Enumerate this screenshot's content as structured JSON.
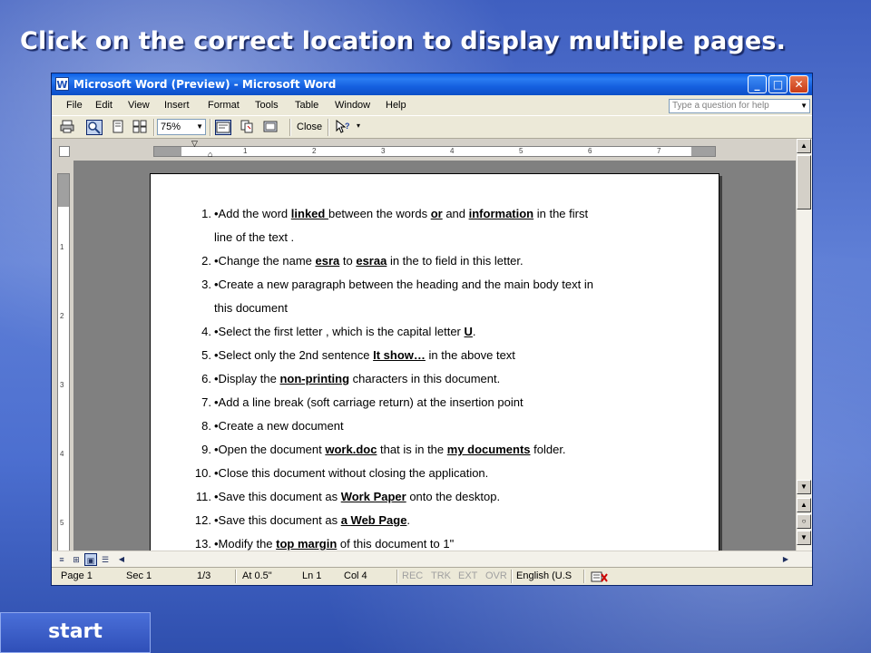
{
  "slide": {
    "instruction": "Click on the correct location to display multiple pages.",
    "start_label": "start"
  },
  "window": {
    "title": "Microsoft Word (Preview) - Microsoft Word",
    "controls": {
      "minimize": "_",
      "maximize": "□",
      "close": "✕"
    }
  },
  "menu": {
    "items": [
      "File",
      "Edit",
      "View",
      "Insert",
      "Format",
      "Tools",
      "Table",
      "Window",
      "Help"
    ],
    "help_placeholder": "Type a question for help"
  },
  "toolbar": {
    "zoom": "75%",
    "close_label": "Close"
  },
  "ruler": {
    "numbers": [
      "1",
      "2",
      "3",
      "4",
      "5",
      "6",
      "7"
    ],
    "vnumbers": [
      "1",
      "2",
      "3",
      "4",
      "5"
    ]
  },
  "document": {
    "items": [
      {
        "num": "1.",
        "parts": [
          [
            "•Add the word ",
            false
          ],
          [
            "linked ",
            true
          ],
          [
            "between the words ",
            false
          ],
          [
            "or",
            true
          ],
          [
            " and ",
            false
          ],
          [
            "information",
            true
          ],
          [
            " in the first",
            false
          ]
        ],
        "cont": "line of the text ."
      },
      {
        "num": "2.",
        "parts": [
          [
            "•Change the name ",
            false
          ],
          [
            "esra",
            true
          ],
          [
            " to ",
            false
          ],
          [
            "esraa",
            true
          ],
          [
            " in the to field in this letter.",
            false
          ]
        ]
      },
      {
        "num": "3.",
        "parts": [
          [
            "•Create a new paragraph between the heading and the main body text in",
            false
          ]
        ],
        "cont": "this document"
      },
      {
        "num": "4.",
        "parts": [
          [
            "•Select the first letter , which is the capital letter ",
            false
          ],
          [
            "U",
            true
          ],
          [
            ".",
            false
          ]
        ]
      },
      {
        "num": "5.",
        "parts": [
          [
            "•Select only the 2nd sentence ",
            false
          ],
          [
            "It show…",
            true
          ],
          [
            " in the above text",
            false
          ]
        ]
      },
      {
        "num": "6.",
        "parts": [
          [
            "•Display the ",
            false
          ],
          [
            "non-printing",
            true
          ],
          [
            " characters in this document.",
            false
          ]
        ]
      },
      {
        "num": "7.",
        "parts": [
          [
            "•Add a line break (soft carriage return) at the insertion point",
            false
          ]
        ]
      },
      {
        "num": "8.",
        "parts": [
          [
            "•Create a new document",
            false
          ]
        ]
      },
      {
        "num": "9.",
        "parts": [
          [
            "•Open the document ",
            false
          ],
          [
            "work.doc",
            true
          ],
          [
            " that is in the ",
            false
          ],
          [
            "my documents",
            true
          ],
          [
            " folder.",
            false
          ]
        ]
      },
      {
        "num": "10.",
        "parts": [
          [
            "•Close this document without closing the application.",
            false
          ]
        ]
      },
      {
        "num": "11.",
        "parts": [
          [
            "•Save this document as ",
            false
          ],
          [
            "Work Paper",
            true
          ],
          [
            " onto the desktop.",
            false
          ]
        ]
      },
      {
        "num": "12.",
        "parts": [
          [
            "•Save this document as ",
            false
          ],
          [
            "a Web Page",
            true
          ],
          [
            ".",
            false
          ]
        ]
      },
      {
        "num": "13.",
        "parts": [
          [
            "•Modify the ",
            false
          ],
          [
            "top margin",
            true
          ],
          [
            " of this document to 1\"",
            false
          ]
        ]
      }
    ]
  },
  "status": {
    "page": "Page 1",
    "sec": "Sec 1",
    "pages": "1/3",
    "at": "At 0.5\"",
    "ln": "Ln 1",
    "col": "Col 4",
    "rec": "REC",
    "trk": "TRK",
    "ext": "EXT",
    "ovr": "OVR",
    "lang": "English (U.S"
  },
  "icons": [
    "print-icon",
    "magnifier-icon",
    "one-page-icon",
    "multiple-pages-icon",
    "view-ruler-icon",
    "shrink-to-fit-icon",
    "full-screen-icon",
    "context-help-icon"
  ]
}
